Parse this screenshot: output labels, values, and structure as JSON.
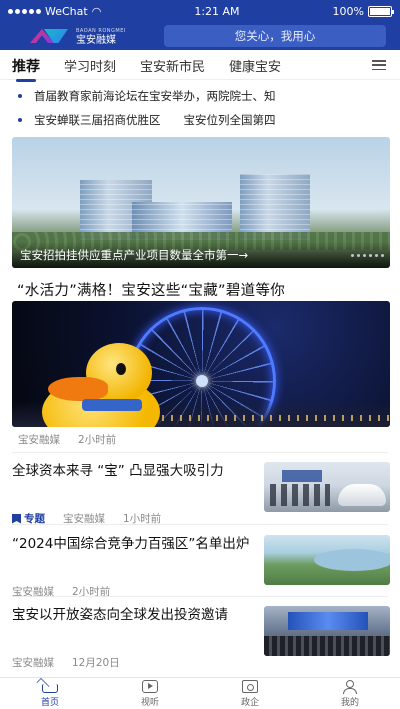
{
  "status": {
    "carrier": "WeChat",
    "time": "1:21 AM",
    "battery": "100%",
    "battery_level": 1.0
  },
  "header": {
    "logo_text": "宝安融媒",
    "logo_small": "BAOAN RONGMEI",
    "search_placeholder": "您关心，我用心"
  },
  "tabs": [
    "推荐",
    "学习时刻",
    "宝安新市民",
    "健康宝安"
  ],
  "active_tab": "推荐",
  "ticker": [
    "首届教育家前海论坛在宝安举办，两院院士、知",
    "宝安蝉联三届招商优胜区　　宝安位列全国第四"
  ],
  "hero": {
    "caption": "宝安招拍挂供应重点产业项目数量全市第一→"
  },
  "feature": {
    "headline": "“水活力”满格！宝安这些“宝藏”碧道等你",
    "source": "宝安融媒",
    "time": "2小时前"
  },
  "articles": [
    {
      "title": "全球资本来寻 “宝” 凸显强大吸引力",
      "tag": "专题",
      "source": "宝安融媒",
      "time": "1小时前"
    },
    {
      "title": "“2024中国综合竞争力百强区”名单出炉",
      "source": "宝安融媒",
      "time": "2小时前"
    },
    {
      "title": "宝安以开放姿态向全球发出投资邀请",
      "source": "宝安融媒",
      "time": "12月20日"
    }
  ],
  "nav": [
    {
      "label": "首页",
      "icon": "home-icon"
    },
    {
      "label": "视听",
      "icon": "video-icon"
    },
    {
      "label": "政企",
      "icon": "gov-icon"
    },
    {
      "label": "我的",
      "icon": "profile-icon"
    }
  ],
  "colors": {
    "brand": "#1f3fa3"
  }
}
